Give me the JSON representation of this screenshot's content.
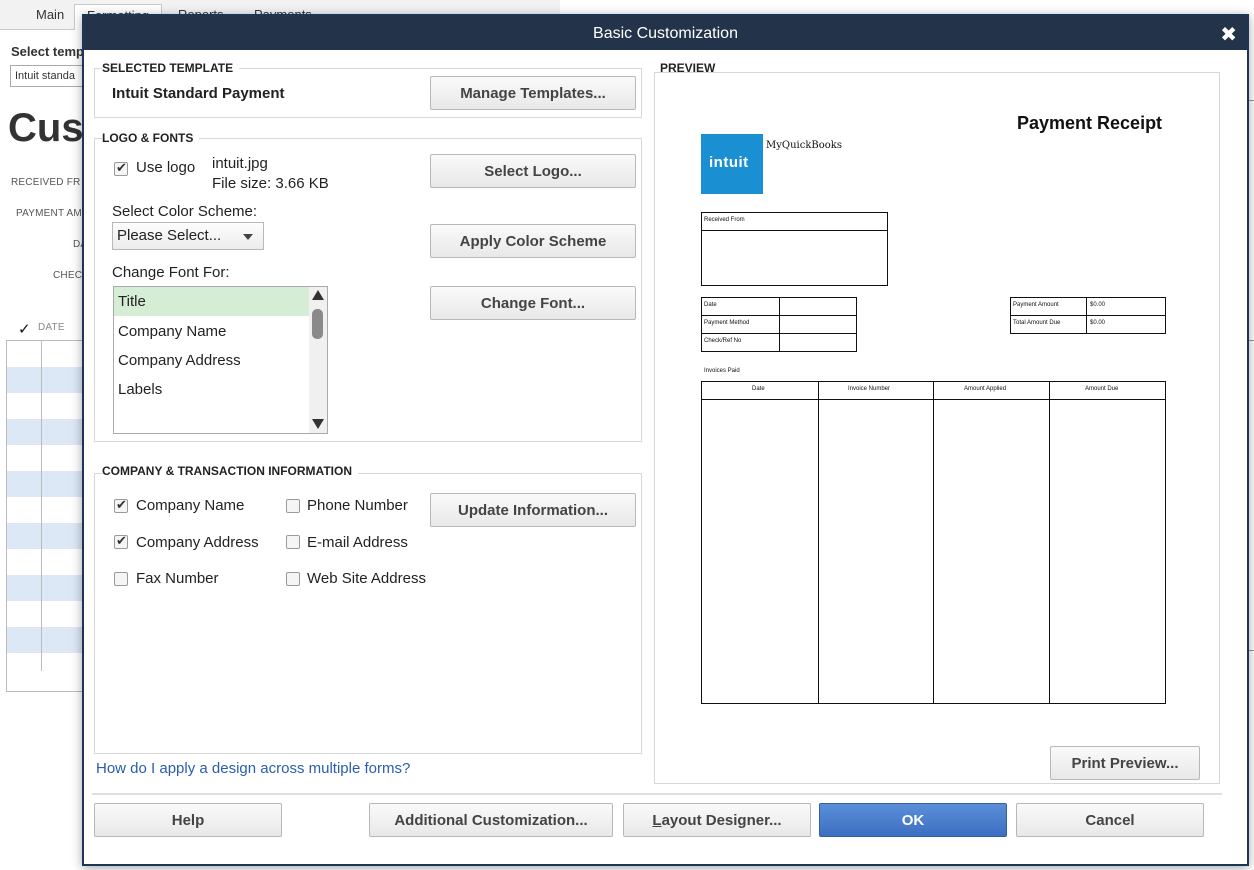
{
  "background": {
    "tabs": [
      "Main",
      "Formatting",
      "Reports",
      "Payments"
    ],
    "select_template_label": "Select temp",
    "template_value": "Intuit standa",
    "big_title": "Cus",
    "labels": [
      "RECEIVED FR",
      "PAYMENT AM",
      "DA",
      "CHEC"
    ],
    "grid_header_check": "✓",
    "grid_header_date": "DATE"
  },
  "dialog": {
    "title": "Basic Customization",
    "close": "✖",
    "selected_template": {
      "header": "SELECTED TEMPLATE",
      "name": "Intuit Standard Payment",
      "manage_button": "Manage Templates..."
    },
    "logo_fonts": {
      "header": "LOGO & FONTS",
      "use_logo_label": "Use logo",
      "use_logo_checked": true,
      "logo_file": "intuit.jpg",
      "logo_size": "File size: 3.66 KB",
      "select_logo_button": "Select Logo...",
      "color_scheme_label": "Select Color Scheme:",
      "color_scheme_value": "Please Select...",
      "apply_color_button": "Apply Color Scheme",
      "change_font_for_label": "Change Font For:",
      "font_items": [
        "Title",
        "Company Name",
        "Company Address",
        "Labels"
      ],
      "selected_font_item": "Title",
      "change_font_button": "Change Font..."
    },
    "company_info": {
      "header": "COMPANY & TRANSACTION INFORMATION",
      "company_name": {
        "label": "Company Name",
        "checked": true
      },
      "phone_number": {
        "label": "Phone Number",
        "checked": false
      },
      "company_address": {
        "label": "Company Address",
        "checked": true
      },
      "email_address": {
        "label": "E-mail Address",
        "checked": false
      },
      "fax_number": {
        "label": "Fax Number",
        "checked": false
      },
      "website_address": {
        "label": "Web Site Address",
        "checked": false
      },
      "update_button": "Update Information..."
    },
    "help_link": "How do I apply a design across multiple forms?",
    "preview": {
      "header": "PREVIEW",
      "receipt_title": "Payment Receipt",
      "logo_text": "intuit",
      "company_name": "MyQuickBooks",
      "received_from": "Received From",
      "date": "Date",
      "payment_method": "Payment Method",
      "check_ref": "Check/Ref No",
      "payment_amount": "Payment Amount",
      "payment_amount_value": "$0.00",
      "total_due": "Total Amount Due",
      "total_due_value": "$0.00",
      "invoices_paid": "Invoices Paid",
      "columns": [
        "Date",
        "Invoice Number",
        "Amount Applied",
        "Amount Due"
      ],
      "print_preview_button": "Print Preview..."
    },
    "buttons": {
      "help": "Help",
      "additional": "Additional Customization...",
      "layout_designer_pre": "",
      "layout_designer_u": "L",
      "layout_designer_post": "ayout Designer...",
      "ok": "OK",
      "cancel": "Cancel"
    }
  }
}
